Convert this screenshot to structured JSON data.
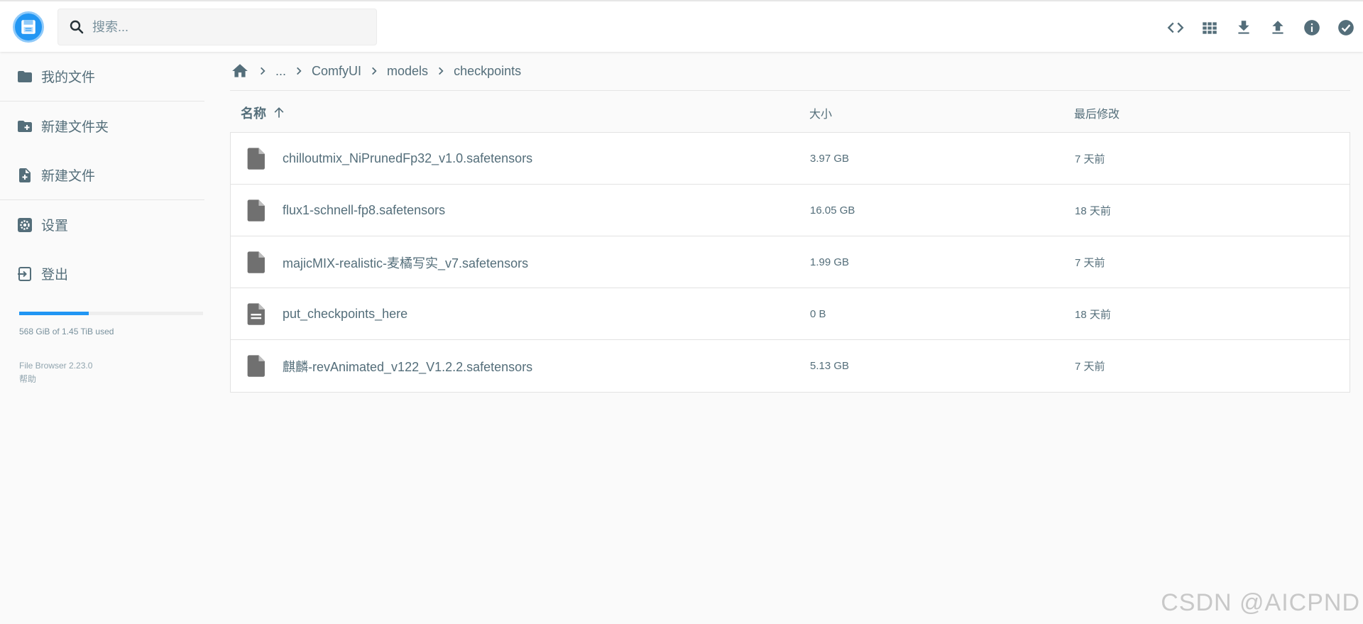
{
  "header": {
    "search_placeholder": "搜索...",
    "toolbar": [
      "code-view-icon",
      "grid-view-icon",
      "download-icon",
      "upload-icon",
      "info-icon",
      "select-check-icon"
    ]
  },
  "sidebar": {
    "items": [
      {
        "label": "我的文件",
        "icon": "folder-icon"
      },
      {
        "label": "新建文件夹",
        "icon": "create-folder-icon"
      },
      {
        "label": "新建文件",
        "icon": "note-add-icon"
      },
      {
        "label": "设置",
        "icon": "settings-icon"
      },
      {
        "label": "登出",
        "icon": "logout-icon"
      }
    ],
    "usage": {
      "text": "568 GiB of 1.45 TiB used",
      "fraction": 0.38
    },
    "version": "File Browser 2.23.0",
    "help": "帮助"
  },
  "breadcrumb": {
    "items": [
      "...",
      "ComfyUI",
      "models",
      "checkpoints"
    ]
  },
  "table": {
    "headers": {
      "name": "名称",
      "size": "大小",
      "modified": "最后修改"
    },
    "rows": [
      {
        "name": "chilloutmix_NiPrunedFp32_v1.0.safetensors",
        "size": "3.97 GB",
        "modified": "7 天前",
        "icon": "file-icon"
      },
      {
        "name": "flux1-schnell-fp8.safetensors",
        "size": "16.05 GB",
        "modified": "18 天前",
        "icon": "file-icon"
      },
      {
        "name": "majicMIX-realistic-麦橘写实_v7.safetensors",
        "size": "1.99 GB",
        "modified": "7 天前",
        "icon": "file-icon"
      },
      {
        "name": "put_checkpoints_here",
        "size": "0 B",
        "modified": "18 天前",
        "icon": "text-file-icon"
      },
      {
        "name": "麒麟-revAnimated_v122_V1.2.2.safetensors",
        "size": "5.13 GB",
        "modified": "7 天前",
        "icon": "file-icon"
      }
    ]
  },
  "watermark": "CSDN @AICPND",
  "colors": {
    "accent": "#2196f3",
    "text": "#546e7a",
    "icon": "#546e7a",
    "file_icon": "#707070"
  }
}
